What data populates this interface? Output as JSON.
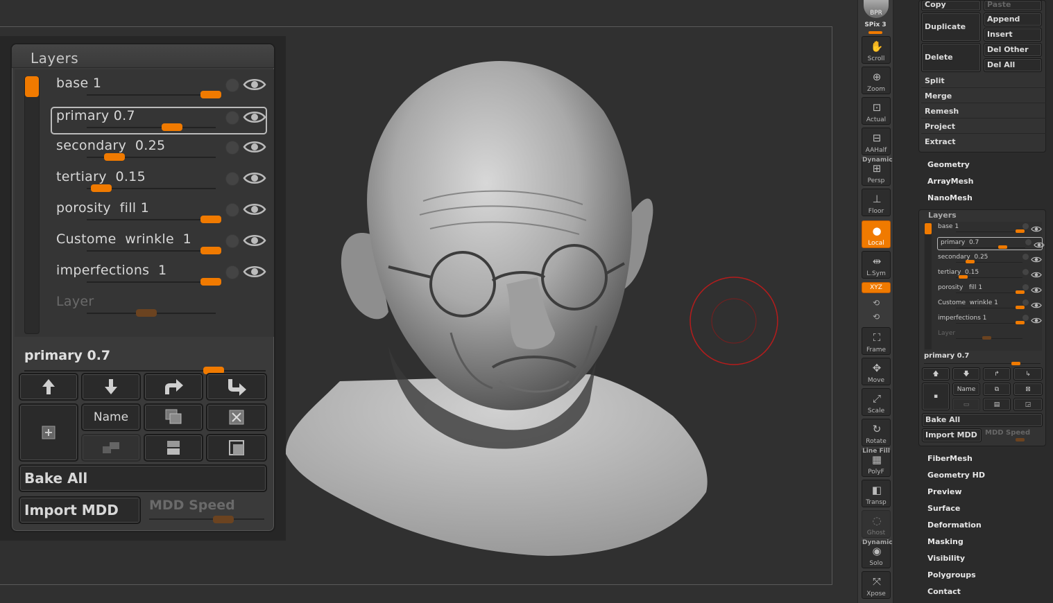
{
  "layers_panel": {
    "title": "Layers",
    "layers": [
      {
        "name": "base 1",
        "value": 1.0
      },
      {
        "name": "primary 0.7",
        "value": 0.7,
        "selected": true
      },
      {
        "name": "secondary  0.25",
        "value": 0.25
      },
      {
        "name": "tertiary  0.15",
        "value": 0.15
      },
      {
        "name": "porosity  fill 1",
        "value": 1.0
      },
      {
        "name": "Custome  wrinkle  1",
        "value": 1.0
      },
      {
        "name": "imperfections  1",
        "value": 1.0
      },
      {
        "name": "Layer",
        "value": 0.5,
        "ghost": true
      }
    ],
    "selected_label": "primary 0.7",
    "selected_value": 0.7,
    "name_button": "Name",
    "bake_all": "Bake  All",
    "import_mdd": "Import  MDD",
    "mdd_speed": "MDD  Speed"
  },
  "shelf": {
    "bpr": "BPR",
    "spix": "SPix 3",
    "buttons": [
      {
        "label": "Scroll",
        "icon": "hand-icon"
      },
      {
        "label": "Zoom",
        "icon": "zoom-icon"
      },
      {
        "label": "Actual",
        "icon": "actual-icon"
      },
      {
        "label": "AAHalf",
        "icon": "aahalf-icon"
      },
      {
        "label": "Persp",
        "icon": "perspective-icon",
        "over": "Dynamic"
      },
      {
        "label": "Floor",
        "icon": "floor-icon"
      },
      {
        "label": "Local",
        "icon": "local-icon",
        "active": true
      },
      {
        "label": "L.Sym",
        "icon": "lsym-icon"
      },
      {
        "label": "Frame",
        "icon": "frame-icon"
      },
      {
        "label": "Move",
        "icon": "move-icon"
      },
      {
        "label": "Scale",
        "icon": "scale-icon"
      },
      {
        "label": "Rotate",
        "icon": "rotate-icon"
      },
      {
        "label": "PolyF",
        "icon": "polyframe-icon",
        "over": "Line Fill"
      },
      {
        "label": "Transp",
        "icon": "transparency-icon"
      },
      {
        "label": "Ghost",
        "icon": "ghost-icon"
      },
      {
        "label": "Solo",
        "icon": "solo-icon",
        "over": "Dynamic"
      },
      {
        "label": "Xpose",
        "icon": "xpose-icon"
      }
    ],
    "xyz": "XYZ"
  },
  "subtool": {
    "copy": "Copy",
    "paste": "Paste",
    "duplicate": "Duplicate",
    "append": "Append",
    "insert": "Insert",
    "delete": "Delete",
    "del_other": "Del  Other",
    "del_all": "Del  All",
    "rows": [
      "Split",
      "Merge",
      "Remesh",
      "Project",
      "Extract"
    ]
  },
  "menu_top": [
    "Geometry",
    "ArrayMesh",
    "NanoMesh"
  ],
  "small_layers": {
    "title": "Layers",
    "layers": [
      {
        "name": "base 1",
        "value": 1.0
      },
      {
        "name": "primary  0.7",
        "value": 0.7,
        "selected": true
      },
      {
        "name": "secondary  0.25",
        "value": 0.25
      },
      {
        "name": "tertiary  0.15",
        "value": 0.15
      },
      {
        "name": "porosity   fill 1",
        "value": 1.0
      },
      {
        "name": "Custome  wrinkle 1",
        "value": 1.0
      },
      {
        "name": "imperfections 1",
        "value": 1.0
      },
      {
        "name": "Layer",
        "value": 0.5,
        "ghost": true
      }
    ],
    "selected_label": "primary 0.7",
    "name_button": "Name",
    "bake_all": "Bake  All",
    "import_mdd": "Import  MDD",
    "mdd_speed": "MDD  Speed"
  },
  "menu_bottom": [
    "FiberMesh",
    "Geometry  HD",
    "Preview",
    "Surface",
    "Deformation",
    "Masking",
    "Visibility",
    "Polygroups",
    "Contact"
  ],
  "colors": {
    "accent": "#f07a00",
    "brush_ring": "#b51c1c"
  }
}
